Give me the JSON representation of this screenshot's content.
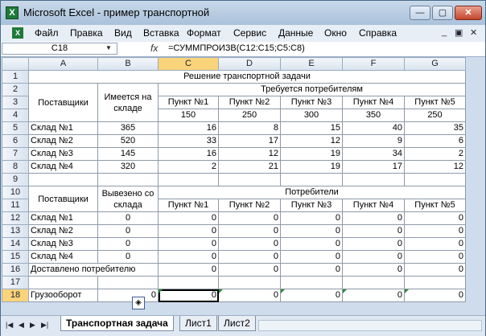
{
  "window": {
    "title": "Microsoft Excel - пример транспортной"
  },
  "menu": {
    "items": [
      "Файл",
      "Правка",
      "Вид",
      "Вставка",
      "Формат",
      "Сервис",
      "Данные",
      "Окно",
      "Справка"
    ],
    "underlined": [
      "Ф",
      "П",
      "В",
      "с",
      "о",
      "С",
      "Д",
      "О",
      "С"
    ]
  },
  "formula_bar": {
    "name_box": "C18",
    "fx": "fx",
    "formula": "=СУММПРОИЗВ(C12:C15;C5:C8)"
  },
  "columns": [
    "A",
    "B",
    "C",
    "D",
    "E",
    "F",
    "G"
  ],
  "rows": [
    "1",
    "2",
    "3",
    "4",
    "5",
    "6",
    "7",
    "8",
    "9",
    "10",
    "11",
    "12",
    "13",
    "14",
    "15",
    "16",
    "17",
    "18"
  ],
  "table1": {
    "title": "Решение транспортной задачи",
    "suppliers_header": "Поставщики",
    "available_header": "Имеется на складе",
    "required_header": "Требуется потребителям",
    "points": [
      "Пункт №1",
      "Пункт №2",
      "Пункт №3",
      "Пункт №4",
      "Пункт №5"
    ],
    "demand": [
      "150",
      "250",
      "300",
      "350",
      "250"
    ],
    "rows": [
      {
        "name": "Склад №1",
        "stock": "365",
        "costs": [
          "16",
          "8",
          "15",
          "40",
          "35"
        ]
      },
      {
        "name": "Склад №2",
        "stock": "520",
        "costs": [
          "33",
          "17",
          "12",
          "9",
          "6"
        ]
      },
      {
        "name": "Склад №3",
        "stock": "145",
        "costs": [
          "16",
          "12",
          "19",
          "34",
          "2"
        ]
      },
      {
        "name": "Склад №4",
        "stock": "320",
        "costs": [
          "2",
          "21",
          "19",
          "17",
          "12"
        ]
      }
    ]
  },
  "table2": {
    "suppliers_header": "Поставщики",
    "shipped_header": "Вывезено со склада",
    "consumers_header": "Потребители",
    "points": [
      "Пункт №1",
      "Пункт №2",
      "Пункт №3",
      "Пункт №4",
      "Пункт №5"
    ],
    "rows": [
      {
        "name": "Склад №1",
        "shipped": "0",
        "values": [
          "0",
          "0",
          "0",
          "0",
          "0"
        ]
      },
      {
        "name": "Склад №2",
        "shipped": "0",
        "values": [
          "0",
          "0",
          "0",
          "0",
          "0"
        ]
      },
      {
        "name": "Склад №3",
        "shipped": "0",
        "values": [
          "0",
          "0",
          "0",
          "0",
          "0"
        ]
      },
      {
        "name": "Склад №4",
        "shipped": "0",
        "values": [
          "0",
          "0",
          "0",
          "0",
          "0"
        ]
      }
    ],
    "delivered_label": "Доставлено потребителю",
    "delivered": [
      "0",
      "0",
      "0",
      "0",
      "0"
    ],
    "turnover_label": "Грузооборот",
    "turnover_b": "0",
    "turnover": [
      "0",
      "0",
      "0",
      "0",
      "0"
    ]
  },
  "tabs": {
    "sheets": [
      "Транспортная задача",
      "Лист1",
      "Лист2"
    ],
    "active": "Транспортная задача"
  },
  "colors": {
    "accent": "#f9d47a",
    "excel_green": "#1f7a3a"
  }
}
